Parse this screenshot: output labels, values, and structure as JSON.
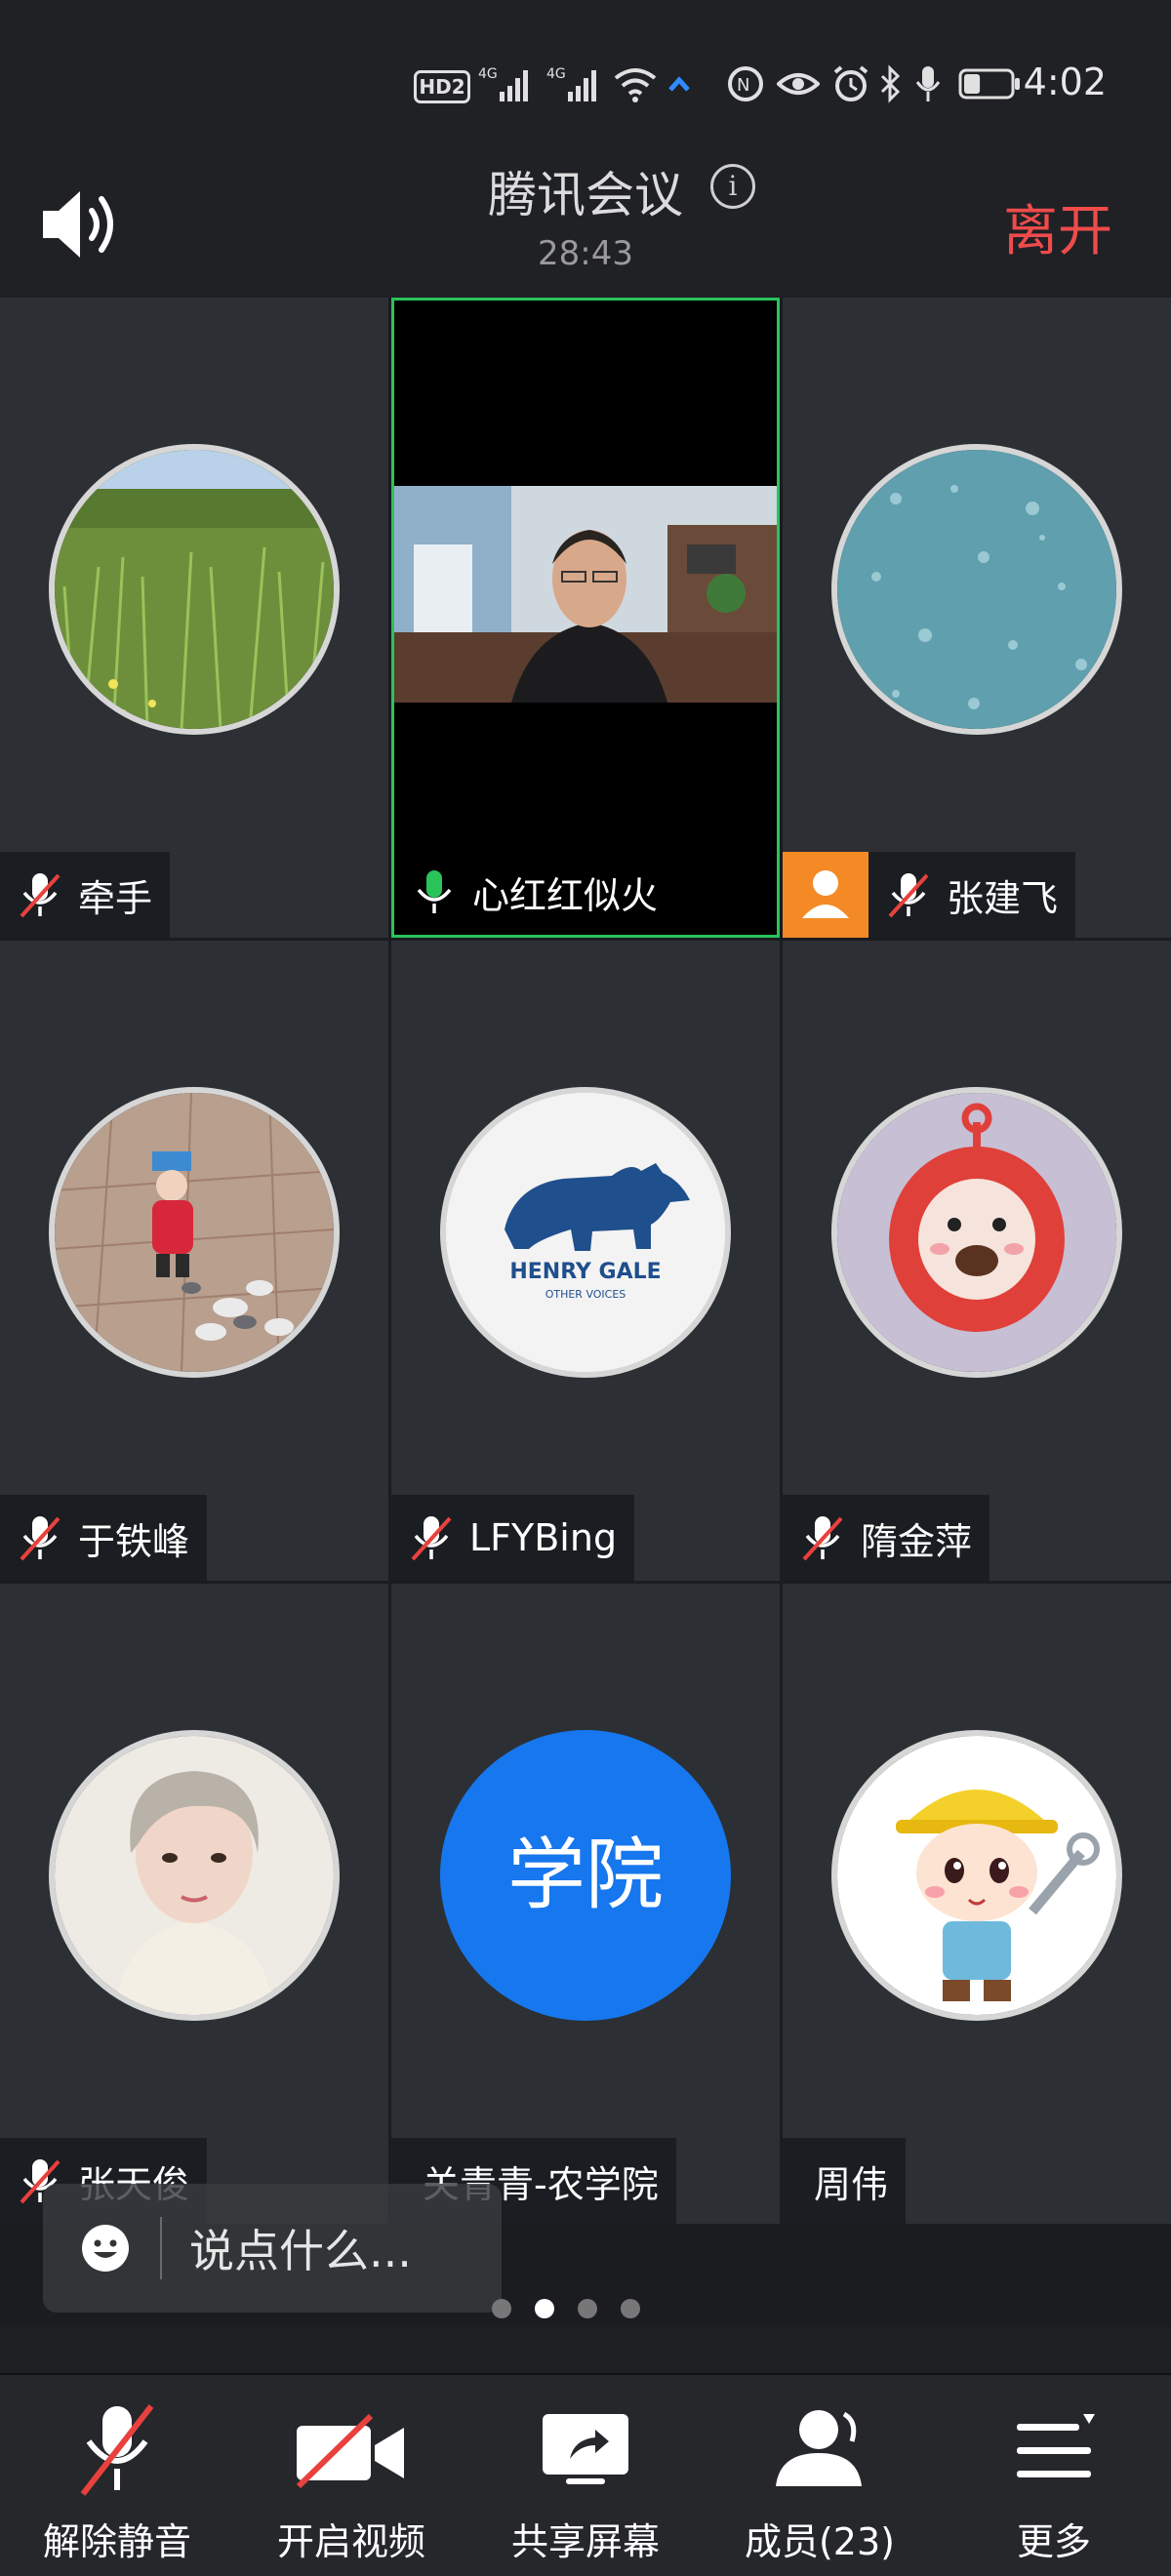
{
  "status_bar": {
    "hd_label": "HD2",
    "net1": "4G",
    "net2": "4G",
    "battery_level": 0.35,
    "time": "4:02",
    "icons": [
      "hd-icon",
      "signal-icon",
      "signal-icon",
      "wifi-icon",
      "data-icon",
      "nfc-icon",
      "eye-icon",
      "alarm-icon",
      "bluetooth-icon",
      "mic-icon",
      "battery-icon"
    ]
  },
  "header": {
    "title": "腾讯会议",
    "timer": "28:43",
    "leave_label": "离开",
    "leave_color": "#ef4b4b"
  },
  "participants": [
    {
      "name": "牵手",
      "muted": true,
      "avatar": "grass-photo"
    },
    {
      "name": "心红红似火",
      "muted": false,
      "video_on": true,
      "active_speaker": true
    },
    {
      "name": "张建飞",
      "muted": true,
      "avatar": "water-drops-photo",
      "host": true
    },
    {
      "name": "于铁峰",
      "muted": true,
      "avatar": "child-with-pigeons-photo"
    },
    {
      "name": "LFYBing",
      "muted": true,
      "avatar": "henry-gale-rhino-logo",
      "logo_text": "HENRY GALE",
      "logo_subtext": "OTHER VOICES"
    },
    {
      "name": "隋金萍",
      "muted": true,
      "avatar": "red-teletubby-cartoon"
    },
    {
      "name": "张天俊",
      "muted": true,
      "avatar": "woman-portrait-photo"
    },
    {
      "name": "关青青-农学院",
      "muted": false,
      "avatar_text": "学院",
      "avatar_color": "#1677ee"
    },
    {
      "name": "周伟",
      "muted": false,
      "avatar": "cartoon-worker"
    }
  ],
  "chat": {
    "placeholder": "说点什么..."
  },
  "pager": {
    "pages": 4,
    "current": 2
  },
  "toolbar": {
    "unmute": "解除静音",
    "start_video": "开启视频",
    "share_screen": "共享屏幕",
    "members": "成员(23)",
    "more": "更多"
  },
  "colors": {
    "active_border": "#29c35a",
    "host_badge": "#f48a25",
    "muted_slash": "#e8413d"
  }
}
